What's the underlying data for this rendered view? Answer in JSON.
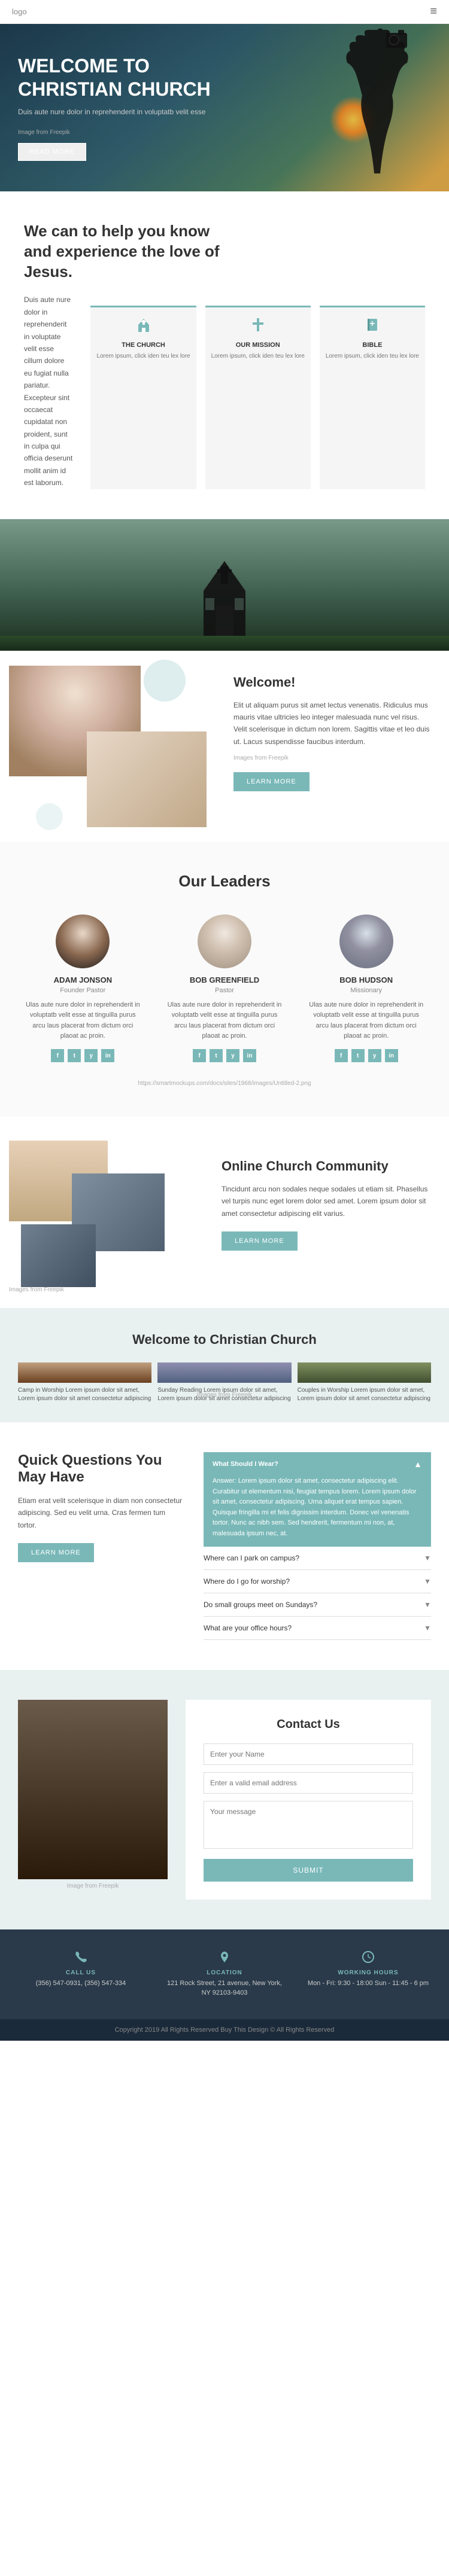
{
  "nav": {
    "logo": "logo",
    "hamburger": "≡"
  },
  "hero": {
    "title": "WELCOME TO\nCHRISTIAN CHURCH",
    "subtitle": "Duis aute nure dolor in reprehenderit in voluptatb velit esse",
    "img_credit": "Image from Freepik",
    "cta_label": "READ MORE"
  },
  "know_section": {
    "heading": "We can to help you know and experience the love of Jesus.",
    "body": "Duis aute nure dolor in reprehenderit in voluptate velit esse cillum dolore eu fugiat nulla pariatur. Excepteur sint occaecat cupidatat non proident, sunt in culpa qui officia deserunt mollit anim id est laborum.",
    "features": [
      {
        "icon": "🏛",
        "title": "THE CHURCH",
        "desc": "Lorem ipsum, click iden teu lex lore",
        "icon_name": "church-icon"
      },
      {
        "icon": "✝",
        "title": "OUR MISSION",
        "desc": "Lorem ipsum, click iden teu lex lore",
        "icon_name": "cross-icon"
      },
      {
        "icon": "📖",
        "title": "BIBLE",
        "desc": "Lorem ipsum, click iden teu lex lore",
        "icon_name": "bible-icon"
      }
    ]
  },
  "welcome_section": {
    "heading": "Welcome!",
    "body1": "Elit ut aliquam purus sit amet lectus venenatis. Ridiculus mus mauris vitae ultricies leo integer malesuada nunc vel risus. Velit scelerisque in dictum non lorem. Sagittis vitae et leo duis ut. Lacus suspendisse faucibus interdum.",
    "img_credit": "Images from Freepik",
    "cta_label": "LEARN MORE"
  },
  "leaders_section": {
    "heading": "Our Leaders",
    "img_credit_url": "https://smartmockups.com/docs/sites/1968/images/Untitled-2.png",
    "leaders": [
      {
        "name": "ADAM JONSON",
        "title": "Founder Pastor",
        "desc": "Ulas aute nure dolor in reprehenderit in voluptatb velit esse at tinguilla purus arcu laus placerat from dictum orci plaoat ac proin.",
        "socials": [
          "f",
          "t",
          "y",
          "in"
        ]
      },
      {
        "name": "BOB GREENFIELD",
        "title": "Pastor",
        "desc": "Ulas aute nure dolor in reprehenderit in voluptatb velit esse at tinguilla purus arcu laus placerat from dictum orci plaoat ac proin.",
        "socials": [
          "f",
          "t",
          "y",
          "in"
        ]
      },
      {
        "name": "BOB HUDSON",
        "title": "Missionary",
        "desc": "Ulas aute nure dolor in reprehenderit in voluptatb velit esse at tinguilla purus arcu laus placerat from dictum orci plaoat ac proin.",
        "socials": [
          "f",
          "t",
          "y",
          "in"
        ]
      }
    ]
  },
  "community_section": {
    "heading": "Online Church Community",
    "body": "Tincidunt arcu non sodales neque sodales ut etiam sit. Phasellus vel turpis nunc eget lorem dolor sed amet. Lorem ipsum dolor sit amet consectetur adipiscing elit varius.",
    "cta_label": "LEARN MORE",
    "img_credit": "Images from Freepik"
  },
  "gallery_section": {
    "heading": "Welcome to Christian Church",
    "items": [
      {
        "caption": "Camp in Worship\nLorem ipsum dolor sit amet, Lorem ipsum dolor sit amet consectetur adipiscing",
        "img_name": "camp-worship-img"
      },
      {
        "caption": "Sunday Reading\nLorem ipsum dolor sit amet, Lorem ipsum dolor sit amet consectetur adipiscing",
        "img_name": "sunday-reading-img"
      },
      {
        "caption": "Couples in Worship\nLorem ipsum dolor sit amet, Lorem ipsum dolor sit amet consectetur adipiscing",
        "img_name": "couples-worship-img"
      }
    ],
    "img_credit": "Images from Freepik"
  },
  "faq_section": {
    "heading": "Quick Questions You May Have",
    "body": "Etiam erat velit scelerisque in diam non consectetur adipiscing. Sed eu velit urna. Cras fermen tum tortor.",
    "cta_label": "LEARN MORE",
    "featured_question": "What Should I Wear?",
    "featured_answer": "Answer: Lorem ipsum dolor sit amet, consectetur adipiscing elit. Curabitur ut elementum nisi, feugiat tempus lorem. Lorem ipsum dolor sit amet, consectetur adipiscing. Urna aliquet erat tempus sapien. Quisque fringilla mi et felis dignissim interdum. Donec vel venenatis tortor. Nunc ac nibh sem. Sed hendrerit, fermentum mi non, at, malesuada ipsum nec, at.",
    "questions": [
      "Where can I park on campus?",
      "Where do I go for worship?",
      "Do small groups meet on Sundays?",
      "What are your office hours?"
    ]
  },
  "contact_section": {
    "heading": "Contact Us",
    "name_placeholder": "Enter your Name",
    "email_placeholder": "Enter a valid email address",
    "message_placeholder": "Your message",
    "submit_label": "Submit",
    "img_credit": "Image from Freepik"
  },
  "footer": {
    "call_label": "CALL US",
    "call_value": "(356) 547-0931, (356) 547-334",
    "location_label": "LOCATION",
    "location_value": "121 Rock Street, 21 avenue, New York, NY 92103-9403",
    "hours_label": "WORKING HOURS",
    "hours_value": "Mon - Fri: 9:30 - 18:00\nSun - 11:45 - 6 pm",
    "copyright": "Copyright 2019 All Rights Reserved Buy This Design © All Rights Reserved"
  }
}
